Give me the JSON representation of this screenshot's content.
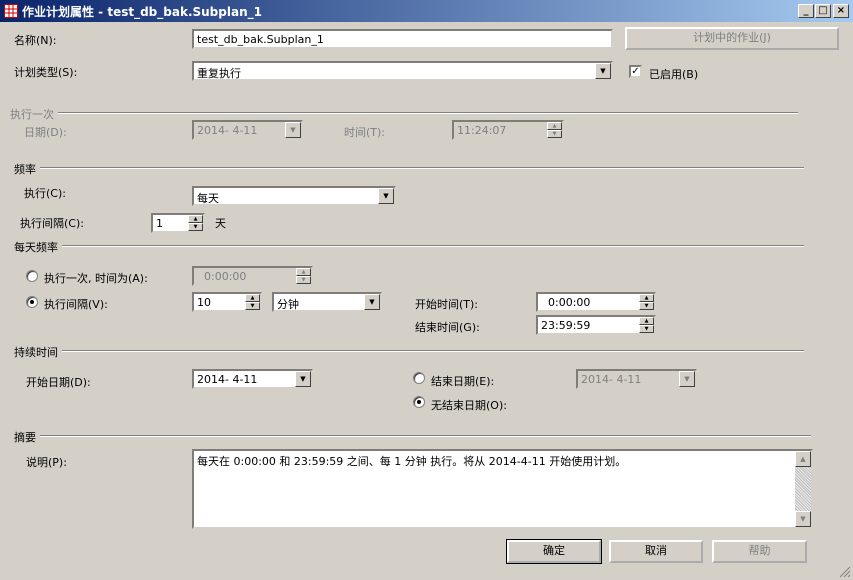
{
  "window": {
    "title": "作业计划属性 - test_db_bak.Subplan_1",
    "icon": "grid-icon",
    "buttons": {
      "minimize": "_",
      "maximize": "□",
      "close": "×"
    }
  },
  "name": {
    "label": "名称(N):",
    "value": "test_db_bak.Subplan_1",
    "jobs_button": "计划中的作业(J)"
  },
  "schedule_type": {
    "label": "计划类型(S):",
    "value": "重复执行",
    "enabled_label": "已启用(B)",
    "enabled": true
  },
  "one_time": {
    "group": "执行一次",
    "date_label": "日期(D):",
    "date_value": "2014- 4-11",
    "time_label": "时间(T):",
    "time_value": "11:24:07"
  },
  "frequency": {
    "group": "频率",
    "occurs_label": "执行(C):",
    "occurs_value": "每天",
    "recurs_label": "执行间隔(C):",
    "recurs_value": "1",
    "recurs_unit": "天"
  },
  "daily_frequency": {
    "group": "每天频率",
    "once_label": "执行一次, 时间为(A):",
    "once_value": "0:00:00",
    "once_selected": false,
    "every_label": "执行间隔(V):",
    "every_value": "10",
    "every_unit": "分钟",
    "every_selected": true,
    "start_time_label": "开始时间(T):",
    "start_time_value": "0:00:00",
    "end_time_label": "结束时间(G):",
    "end_time_value": "23:59:59"
  },
  "duration": {
    "group": "持续时间",
    "start_date_label": "开始日期(D):",
    "start_date_value": "2014- 4-11",
    "end_date_label": "结束日期(E):",
    "end_date_value": "2014- 4-11",
    "end_date_selected": false,
    "no_end_label": "无结束日期(O):",
    "no_end_selected": true
  },
  "summary": {
    "group": "摘要",
    "desc_label": "说明(P):",
    "desc_value": "每天在 0:00:00 和 23:59:59 之间、每 1 分钟 执行。将从 2014-4-11 开始使用计划。"
  },
  "footer": {
    "ok": "确定",
    "cancel": "取消",
    "help": "帮助"
  },
  "colors": {
    "face": "#d4d0c8",
    "title_start": "#0a246a",
    "title_end": "#a6caf0",
    "disabled_text": "#808080"
  }
}
